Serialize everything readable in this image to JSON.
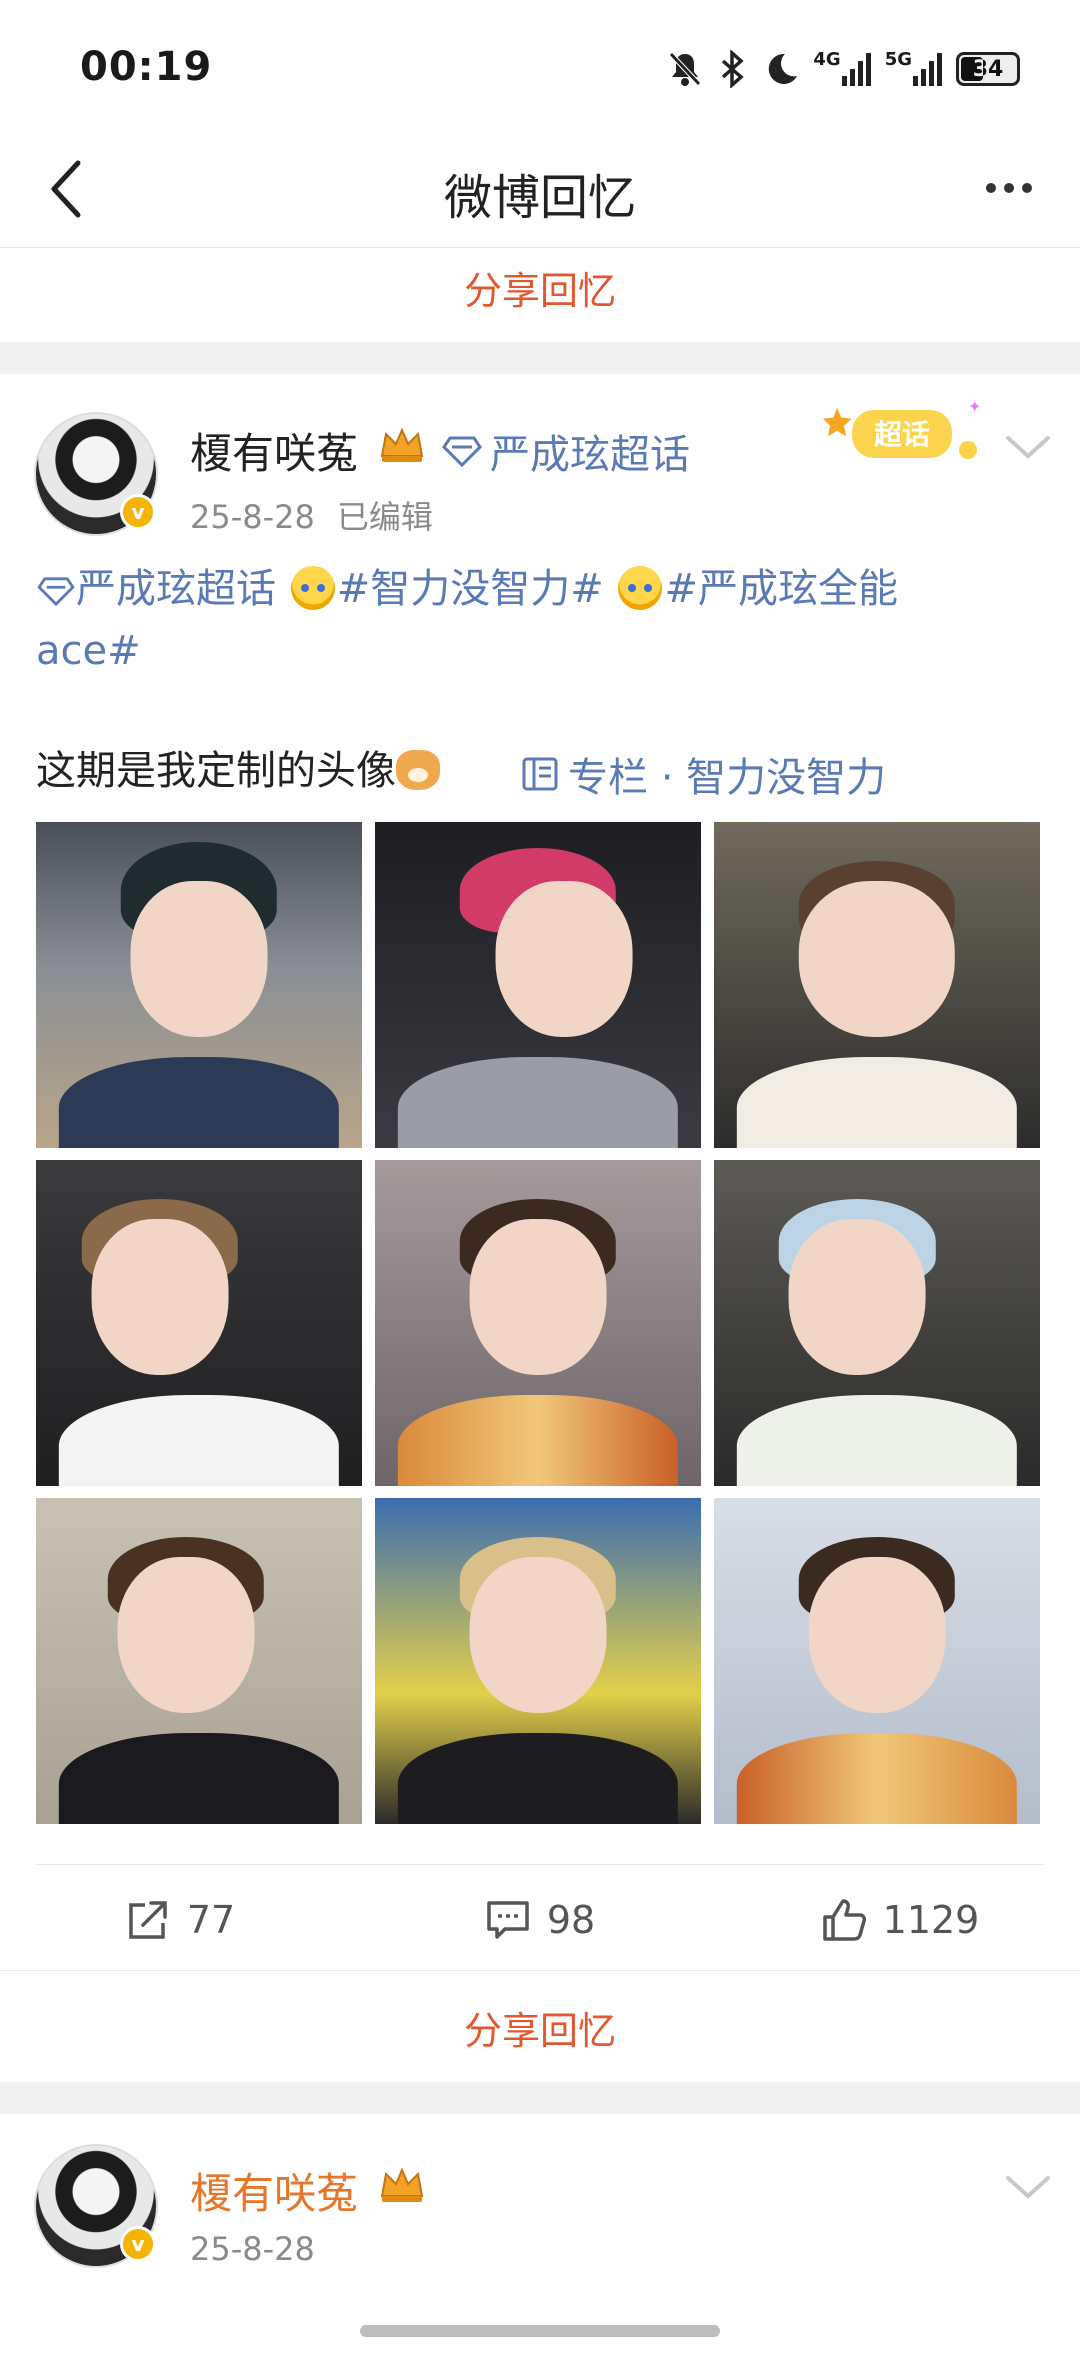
{
  "status_bar": {
    "time": "00:19",
    "net_4g": "4G",
    "net_5g": "5G",
    "battery": "34"
  },
  "header": {
    "title": "微博回忆"
  },
  "share_label": "分享回忆",
  "post": {
    "username": "榎有咲菟",
    "supertopic": "严成玹超话",
    "date": "25-8-28",
    "edited": "已编辑",
    "badge_text": "超话",
    "line1_link": "严成玹超话",
    "line1_tag1": "#智力没智力#",
    "line1_tag2": "#严成玹全能",
    "line2_tag": "ace#",
    "body_text": "这期是我定制的头像",
    "column_label": "专栏 · 智力没智力",
    "photo_count": 9,
    "actions": {
      "repost": "77",
      "comment": "98",
      "like": "1129"
    }
  },
  "next_post": {
    "username": "榎有咲菟",
    "date": "25-8-28"
  },
  "colors": {
    "accent_orange": "#e0582f",
    "link_blue": "#5a7ab5",
    "username_orange": "#e5762a"
  }
}
